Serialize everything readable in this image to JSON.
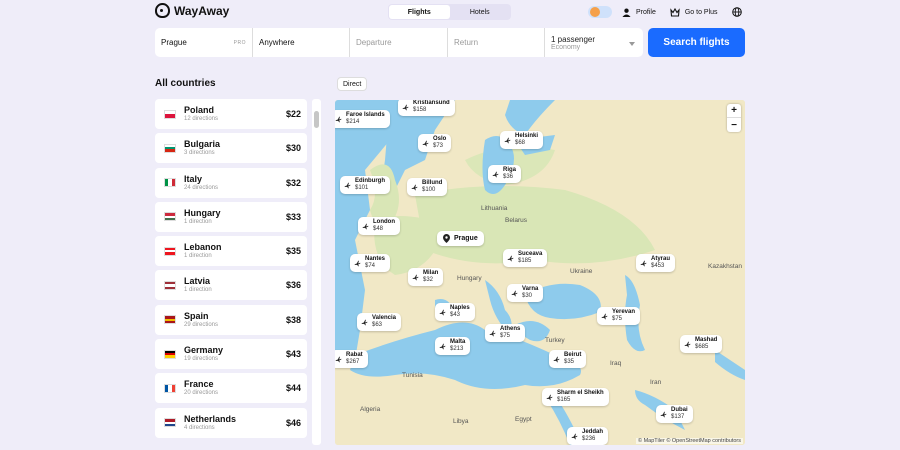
{
  "brand": {
    "name": "WayAway"
  },
  "modes": [
    {
      "label": "Flights",
      "active": true
    },
    {
      "label": "Hotels",
      "active": false
    }
  ],
  "header": {
    "profile_label": "Profile",
    "plus_label": "Go to Plus"
  },
  "search": {
    "origin": "Prague",
    "origin_badge": "PRO",
    "destination": "Anywhere",
    "departure_placeholder": "Departure",
    "return_placeholder": "Return",
    "passengers": "1 passenger",
    "cabin": "Economy",
    "button_label": "Search flights"
  },
  "list_title": "All countries",
  "countries": [
    {
      "name": "Poland",
      "directions": "12 directions",
      "price": "$22",
      "flag": [
        "#ffffff",
        "#dc143c"
      ]
    },
    {
      "name": "Bulgaria",
      "directions": "3 directions",
      "price": "$30",
      "flag": [
        "#ffffff",
        "#00966e",
        "#d62612"
      ]
    },
    {
      "name": "Italy",
      "directions": "24 directions",
      "price": "$32",
      "flag": [
        "#009246",
        "#ffffff",
        "#ce2b37"
      ]
    },
    {
      "name": "Hungary",
      "directions": "1 direction",
      "price": "$33",
      "flag": [
        "#cd2a3e",
        "#ffffff",
        "#436f4d"
      ]
    },
    {
      "name": "Lebanon",
      "directions": "1 direction",
      "price": "$35",
      "flag": [
        "#ee161f",
        "#ffffff",
        "#ee161f"
      ]
    },
    {
      "name": "Latvia",
      "directions": "1 direction",
      "price": "$36",
      "flag": [
        "#9e3039",
        "#ffffff",
        "#9e3039"
      ]
    },
    {
      "name": "Spain",
      "directions": "29 directions",
      "price": "$38",
      "flag": [
        "#aa151b",
        "#f1bf00",
        "#aa151b"
      ]
    },
    {
      "name": "Germany",
      "directions": "19 directions",
      "price": "$43",
      "flag": [
        "#000000",
        "#dd0000",
        "#ffce00"
      ]
    },
    {
      "name": "France",
      "directions": "20 directions",
      "price": "$44",
      "flag": [
        "#0055a4",
        "#ffffff",
        "#ef4135"
      ]
    },
    {
      "name": "Netherlands",
      "directions": "4 directions",
      "price": "$46",
      "flag": [
        "#ae1c28",
        "#ffffff",
        "#21468b"
      ]
    }
  ],
  "map": {
    "direct_label": "Direct",
    "origin_city": "Prague",
    "zoom_in": "+",
    "zoom_out": "−",
    "attribution": "© MapTiler © OpenStreetMap contributors",
    "region_labels": [
      "Lithuania",
      "Belarus",
      "Ukraine",
      "Hungary",
      "Kazakhstan",
      "Turkey",
      "Tunisia",
      "Algeria",
      "Libya",
      "Egypt",
      "Iraq",
      "Iran"
    ],
    "destinations": [
      {
        "city": "Faroe Islands",
        "price": "$214"
      },
      {
        "city": "Kristiansund",
        "price": "$158"
      },
      {
        "city": "Oslo",
        "price": "$73"
      },
      {
        "city": "Helsinki",
        "price": "$68"
      },
      {
        "city": "Edinburgh",
        "price": "$101"
      },
      {
        "city": "Billund",
        "price": "$100"
      },
      {
        "city": "Riga",
        "price": "$36"
      },
      {
        "city": "London",
        "price": "$48"
      },
      {
        "city": "Suceava",
        "price": "$185"
      },
      {
        "city": "Atyrau",
        "price": "$453"
      },
      {
        "city": "Nantes",
        "price": "$74"
      },
      {
        "city": "Milan",
        "price": "$32"
      },
      {
        "city": "Varna",
        "price": "$30"
      },
      {
        "city": "Naples",
        "price": "$43"
      },
      {
        "city": "Valencia",
        "price": "$63"
      },
      {
        "city": "Yerevan",
        "price": "$75"
      },
      {
        "city": "Athens",
        "price": "$75"
      },
      {
        "city": "Malta",
        "price": "$213"
      },
      {
        "city": "Mashad",
        "price": "$685"
      },
      {
        "city": "Rabat",
        "price": "$267"
      },
      {
        "city": "Beirut",
        "price": "$35"
      },
      {
        "city": "Sharm el Sheikh",
        "price": "$165"
      },
      {
        "city": "Dubai",
        "price": "$137"
      },
      {
        "city": "Jeddah",
        "price": "$236"
      }
    ]
  }
}
